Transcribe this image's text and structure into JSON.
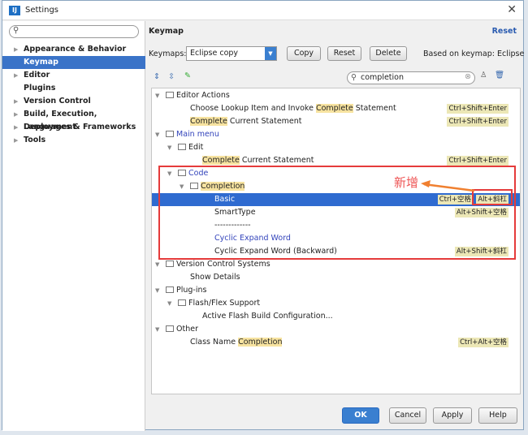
{
  "window": {
    "title": "Settings",
    "logo": "IJ"
  },
  "sidebar": {
    "search_placeholder": "",
    "items": [
      {
        "label": "Appearance & Behavior",
        "arrow": true
      },
      {
        "label": "Keymap",
        "selected": true
      },
      {
        "label": "Editor",
        "arrow": true
      },
      {
        "label": "Plugins"
      },
      {
        "label": "Version Control",
        "arrow": true
      },
      {
        "label": "Build, Execution, Deployment",
        "arrow": true
      },
      {
        "label": "Languages & Frameworks",
        "arrow": true
      },
      {
        "label": "Tools",
        "arrow": true
      }
    ]
  },
  "header": {
    "title": "Keymap",
    "reset_link": "Reset"
  },
  "keymaps": {
    "label": "Keymaps:",
    "value": "Eclipse copy",
    "copy": "Copy",
    "reset": "Reset",
    "delete": "Delete",
    "based_on": "Based on keymap: Eclipse"
  },
  "search": {
    "value": "completion"
  },
  "tree": [
    {
      "indent": 0,
      "tri": true,
      "folder": true,
      "parts": [
        {
          "t": "Editor Actions"
        }
      ]
    },
    {
      "indent": 2,
      "parts": [
        {
          "t": "Choose Lookup Item and Invoke "
        },
        {
          "t": "Complete",
          "hl": true
        },
        {
          "t": " Statement"
        }
      ],
      "keys": [
        "Ctrl+Shift+Enter"
      ]
    },
    {
      "indent": 2,
      "parts": [
        {
          "t": "Complete",
          "hl": true
        },
        {
          "t": " Current Statement"
        }
      ],
      "keys": [
        "Ctrl+Shift+Enter"
      ]
    },
    {
      "indent": 0,
      "tri": true,
      "folder": true,
      "blue": true,
      "parts": [
        {
          "t": "Main menu"
        }
      ]
    },
    {
      "indent": 1,
      "tri": true,
      "folder": true,
      "parts": [
        {
          "t": "Edit"
        }
      ]
    },
    {
      "indent": 3,
      "parts": [
        {
          "t": "Complete",
          "hl": true
        },
        {
          "t": " Current Statement"
        }
      ],
      "keys": [
        "Ctrl+Shift+Enter"
      ]
    },
    {
      "indent": 1,
      "tri": true,
      "folder": true,
      "blue": true,
      "parts": [
        {
          "t": "Code"
        }
      ]
    },
    {
      "indent": 2,
      "tri": true,
      "folder": true,
      "parts": [
        {
          "t": "Completion",
          "hl": true
        }
      ]
    },
    {
      "indent": 4,
      "selected": true,
      "parts": [
        {
          "t": "Basic"
        }
      ],
      "keys": [
        "Ctrl+空格",
        "Alt+斜杠"
      ]
    },
    {
      "indent": 4,
      "parts": [
        {
          "t": "SmartType"
        }
      ],
      "keys": [
        "Alt+Shift+空格"
      ]
    },
    {
      "indent": 4,
      "parts": [
        {
          "t": "-------------"
        }
      ]
    },
    {
      "indent": 4,
      "blue": true,
      "parts": [
        {
          "t": "Cyclic Expand Word"
        }
      ]
    },
    {
      "indent": 4,
      "parts": [
        {
          "t": "Cyclic Expand Word (Backward)"
        }
      ],
      "keys": [
        "Alt+Shift+斜杠"
      ]
    },
    {
      "indent": 0,
      "tri": true,
      "folder": true,
      "parts": [
        {
          "t": "Version Control Systems"
        }
      ]
    },
    {
      "indent": 2,
      "parts": [
        {
          "t": "Show Details"
        }
      ]
    },
    {
      "indent": 0,
      "tri": true,
      "folder": true,
      "parts": [
        {
          "t": "Plug-ins"
        }
      ]
    },
    {
      "indent": 1,
      "tri": true,
      "folder": true,
      "parts": [
        {
          "t": "Flash/Flex Support"
        }
      ]
    },
    {
      "indent": 3,
      "parts": [
        {
          "t": "Active Flash Build Configuration..."
        }
      ]
    },
    {
      "indent": 0,
      "tri": true,
      "folder": true,
      "parts": [
        {
          "t": "Other"
        }
      ]
    },
    {
      "indent": 2,
      "parts": [
        {
          "t": "Class Name "
        },
        {
          "t": "Completion",
          "hl": true
        }
      ],
      "keys": [
        "Ctrl+Alt+空格"
      ]
    }
  ],
  "annotation": {
    "text": "新增",
    "color": "#e53b3b"
  },
  "footer": {
    "ok": "OK",
    "cancel": "Cancel",
    "apply": "Apply",
    "help": "Help"
  },
  "colors": {
    "accent": "#3a73c8",
    "highlight": "#f7e3a0",
    "annotation": "#e53b3b"
  }
}
